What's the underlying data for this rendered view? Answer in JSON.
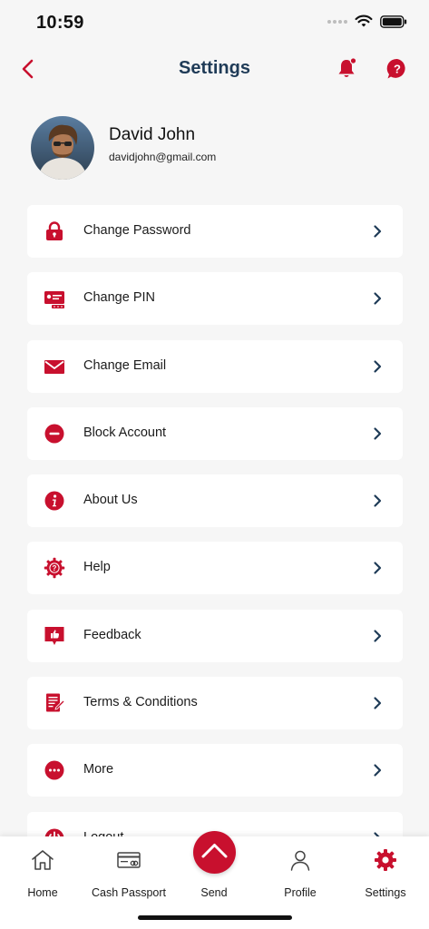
{
  "status_bar": {
    "time": "10:59"
  },
  "header": {
    "title": "Settings"
  },
  "profile": {
    "name": "David John",
    "email": "davidjohn@gmail.com"
  },
  "menu": [
    {
      "label": "Change Password",
      "icon": "lock-icon"
    },
    {
      "label": "Change PIN",
      "icon": "pin-card-icon"
    },
    {
      "label": "Change Email",
      "icon": "envelope-icon"
    },
    {
      "label": "Block Account",
      "icon": "block-icon"
    },
    {
      "label": "About Us",
      "icon": "info-icon"
    },
    {
      "label": "Help",
      "icon": "help-gear-icon"
    },
    {
      "label": "Feedback",
      "icon": "feedback-icon"
    },
    {
      "label": "Terms & Conditions",
      "icon": "document-icon"
    },
    {
      "label": "More",
      "icon": "more-icon"
    },
    {
      "label": "Logout",
      "icon": "logout-icon"
    }
  ],
  "bottom_nav": {
    "home": "Home",
    "cash_passport": "Cash Passport",
    "send": "Send",
    "profile": "Profile",
    "settings": "Settings"
  },
  "colors": {
    "brand": "#c8102e",
    "title": "#1f3b57",
    "chevron": "#1f3b57",
    "background": "#f6f6f6"
  }
}
